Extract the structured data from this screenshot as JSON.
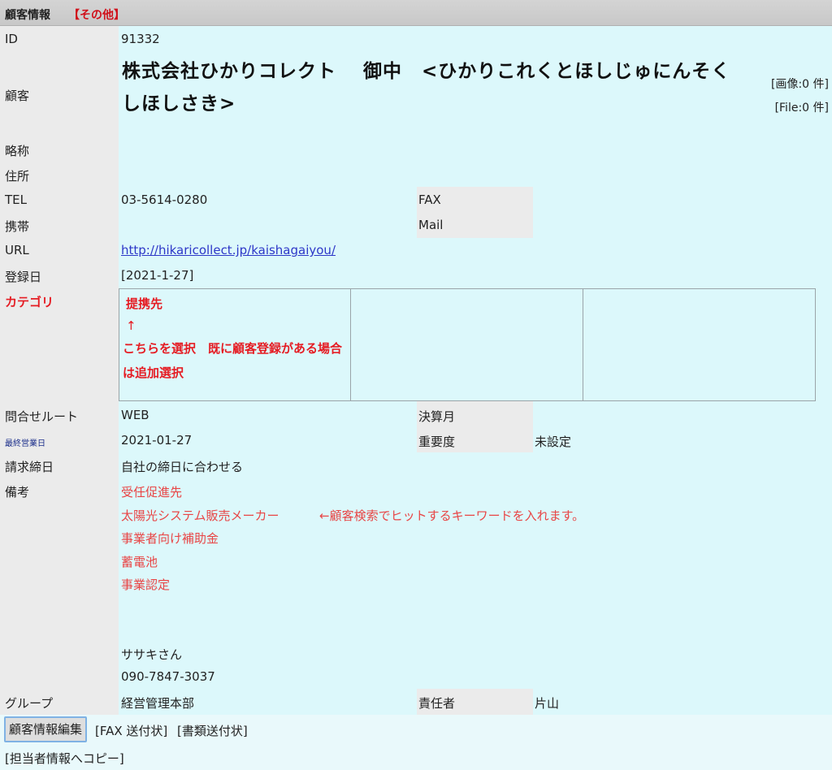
{
  "header": {
    "title": "顧客情報",
    "tag": "【その他】"
  },
  "labels": {
    "id": "ID",
    "customer": "顧客",
    "abbr": "略称",
    "address": "住所",
    "tel": "TEL",
    "fax": "FAX",
    "mobile": "携帯",
    "mail": "Mail",
    "url": "URL",
    "reg_date": "登録日",
    "category": "カテゴリ",
    "inquiry_route": "問合せルート",
    "settlement_month": "決算月",
    "last_business_day": "最終営業日",
    "importance": "重要度",
    "billing_close": "請求締日",
    "remarks": "備考",
    "group": "グループ",
    "manager": "責任者"
  },
  "values": {
    "id": "91332",
    "customer_name": "株式会社ひかりコレクト　 御中　<ひかりこれくとほしじゅにんそくしほしさき>",
    "image_count": "[画像:0 件]",
    "file_count": "[File:0 件]",
    "tel": "03-5614-0280",
    "url": "http://hikaricollect.jp/kaishagaiyou/",
    "reg_date": "[2021-1-27]",
    "inquiry_route": "WEB",
    "last_business_day": "2021-01-27",
    "importance": "未設定",
    "billing_close": "自社の締日に合わせる",
    "group": "経営管理本部",
    "manager": "片山"
  },
  "category": {
    "selected": "提携先",
    "arrow": "↑",
    "note": "こちらを選択　既に顧客登録がある場合は追加選択"
  },
  "remarks": {
    "line1": "受任促進先",
    "line2": "太陽光システム販売メーカー",
    "line2_note": "←顧客検索でヒットするキーワードを入れます。",
    "line3": "事業者向け補助金",
    "line4": "蓄電池",
    "line5": "事業認定",
    "contact_name": "ササキさん",
    "contact_phone": "090-7847-3037"
  },
  "actions": {
    "edit": "顧客情報編集",
    "fax_cover": "[FAX 送付状]",
    "doc_cover": "[書類送付状]",
    "copy_to_contact": "[担当者情報へコピー]"
  },
  "colors": {
    "accent_red": "#e51c23",
    "link_blue": "#2d37c8",
    "value_bg": "#dcf8fb"
  }
}
